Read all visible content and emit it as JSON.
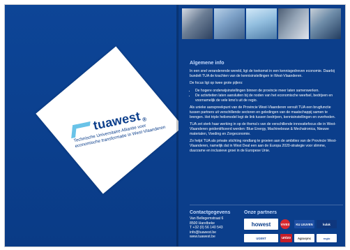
{
  "brand": {
    "logo_word": "tuawest",
    "logo_sup": "®",
    "tagline_lines": [
      "Technische Universitaire Alliantie voor",
      "economische transformatie in West-Vlaanderen"
    ]
  },
  "photos": [
    {
      "icon": "laboratory-photo"
    },
    {
      "icon": "office-photo"
    },
    {
      "icon": "coastal-ship-photo"
    },
    {
      "icon": "industry-photo"
    },
    {
      "icon": "meeting-photo"
    }
  ],
  "main": {
    "heading": "Algemene info",
    "para1": "In een snel veranderende wereld, ligt de toekomst in een kennisgedreven economie. Daarbij bundelt TUA de krachten van de kennisinstellingen in West-Vlaanderen.",
    "para2": "De focus ligt op twee grote pijlers:",
    "list": [
      "De hogere onderwijsinstellingen binnen de provincie meer laten samenwerken.",
      "De activiteiten laten aansluiten bij de noden van het economische weefsel, bedrijven en voornamelijk de vele kmo's uit de regio."
    ],
    "para3": "Als unieke aanspreekpunt van de Provincie West-Vlaanderen vervult TUA een brugfunctie tussen partners uit verschillende sectoren en geledingen van de maatschappij samen te brengen. Het triple helixmodel legt de link tussen bedrijven, kennisinstellingen en overheden.",
    "para4": "TUA zet sterk haar werking in op de thema's van de verschillende innovatiefocus die in West-Vlaanderen geidentificeerd werden: Blue Energy, Machinebouw & Mechatronica, Nieuwe materialen, Voeding en Zorgeconomie.",
    "para5": "Zo helpt TUA als private stichting rondlang te groeien aan de ambities van de Provincie West-Vlaanderen, namelijk dat in West Deal een aan de Europa 2020-strategie voor slimme, duurzame en inclusieve groei in de Europese Unie."
  },
  "contact": {
    "title": "Contactgegevens",
    "lines": [
      "Van Bellegemstraat 6",
      "8500 Harelbeke",
      "T +32 (0) 56 140 543",
      "info@tuawest.be",
      "www.tuawest.be"
    ]
  },
  "partners": {
    "title": "Onze partners",
    "labels": [
      "howest",
      "VIVES",
      "KU LEUVEN",
      "kulak",
      "UGENT",
      "unizo",
      "Agrasync",
      "regio"
    ]
  },
  "colors": {
    "left_blue": "#0d4597",
    "right_blue": "#0b3e8b",
    "accent": "#69c3e8",
    "heading": "#c7dcff"
  }
}
